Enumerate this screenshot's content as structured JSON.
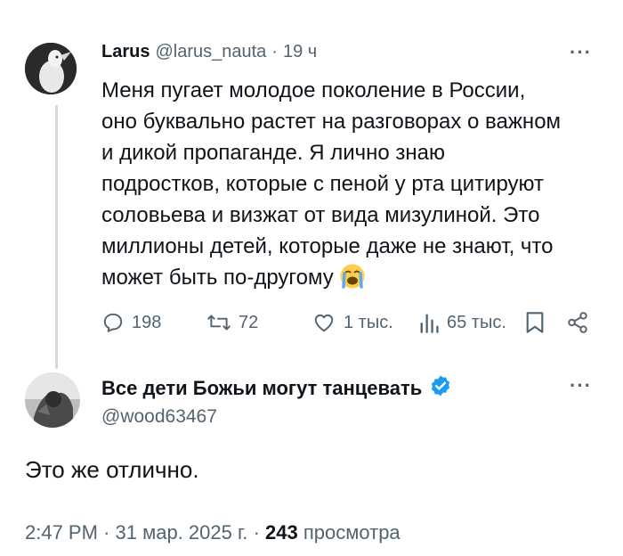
{
  "tweet": {
    "author_name": "Larus",
    "author_handle": "@larus_nauta",
    "separator": "·",
    "time_ago": "19 ч",
    "text": "Меня пугает молодое поколение в России,\nоно буквально растет на разговорах о важном\nи дикой пропаганде. Я лично знаю\nподростков, которые с пеной у рта цитируют\nсоловьева и визжат от вида мизулиной. Это\nмиллионы детей, которые даже не знают, что\nможет быть по-другому",
    "emoji": "loudly-crying-face",
    "more_label": "···",
    "actions": {
      "replies": "198",
      "reposts": "72",
      "likes": "1 тыс.",
      "views": "65 тыс."
    }
  },
  "reply": {
    "author_name": "Все дети Божьи могут танцевать",
    "author_handle": "@wood63467",
    "verified": true,
    "more_label": "···",
    "text": "Это же отлично.",
    "time": "2:47 PM",
    "dot1": "·",
    "date": "31 мар. 2025 г.",
    "dot2": "·",
    "views_count": "243",
    "views_label": "просмотра"
  },
  "colors": {
    "text_primary": "#0f1419",
    "text_secondary": "#536471",
    "verified_blue": "#1d9bf0",
    "thread_line": "#cfd9de"
  }
}
